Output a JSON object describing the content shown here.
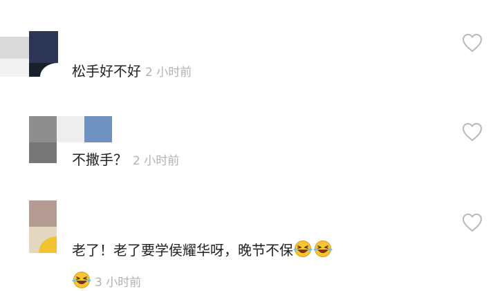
{
  "comments": [
    {
      "text": "松手好不好",
      "time": "2 小时前",
      "like_icon": "heart-outline-icon"
    },
    {
      "text": "不撒手？",
      "time": "2 小时前",
      "like_icon": "heart-outline-icon"
    },
    {
      "text": "老了！老了要学侯耀华呀，晚节不保",
      "time": "3 小时前",
      "emoji": "laughing-face-emoji",
      "like_icon": "heart-outline-icon"
    }
  ],
  "colors": {
    "text": "#222222",
    "time": "#b2b2b2",
    "heart": "#b8b8b8"
  }
}
